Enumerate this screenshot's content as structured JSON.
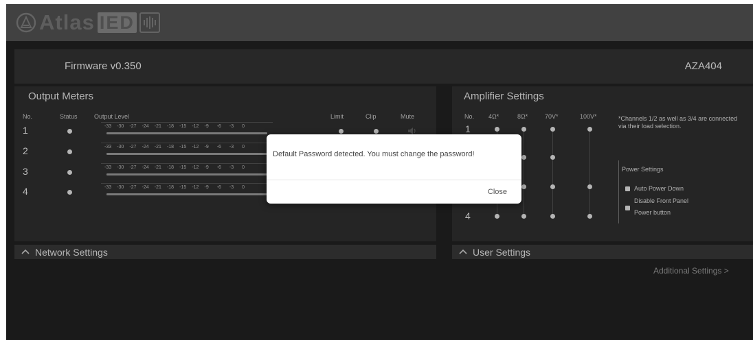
{
  "header": {
    "logo_text_1": "Atlas",
    "logo_text_2": "IED",
    "firmware": "Firmware v0.350",
    "model": "AZA404"
  },
  "output_meters": {
    "title": "Output Meters",
    "col_no": "No.",
    "col_status": "Status",
    "col_level": "Output Level",
    "col_limit": "Limit",
    "col_clip": "Clip",
    "col_mute": "Mute",
    "ticks": [
      "-33",
      "-30",
      "-27",
      "-24",
      "-21",
      "-18",
      "-15",
      "-12",
      "-9",
      "-6",
      "-3",
      "0"
    ],
    "channels": [
      {
        "no": "1"
      },
      {
        "no": "2"
      },
      {
        "no": "3"
      },
      {
        "no": "4"
      }
    ]
  },
  "amplifier_settings": {
    "title": "Amplifier Settings",
    "col_no": "No.",
    "col_4ohm": "4Ω*",
    "col_8ohm": "8Ω*",
    "col_70v": "70V*",
    "col_100v": "100V*",
    "note": "*Channels 1/2 as well as 3/4 are connected via their load selection.",
    "channels": [
      {
        "no": "1"
      },
      {
        "no": "4"
      }
    ],
    "power_settings": {
      "title": "Power Settings",
      "auto_power_down": "Auto Power Down",
      "disable_front_panel_1": "Disable Front Panel",
      "disable_front_panel_2": "Power button"
    }
  },
  "network_settings": {
    "label": "Network Settings"
  },
  "user_settings": {
    "label": "User Settings"
  },
  "additional_settings": {
    "label": "Additional Settings >"
  },
  "dialog": {
    "message": "Default Password detected. You must change the password!",
    "close_label": "Close"
  },
  "colors": {
    "background": "#1e1e1e",
    "panel": "#2b2b2b",
    "dialog": "#ffffff"
  }
}
